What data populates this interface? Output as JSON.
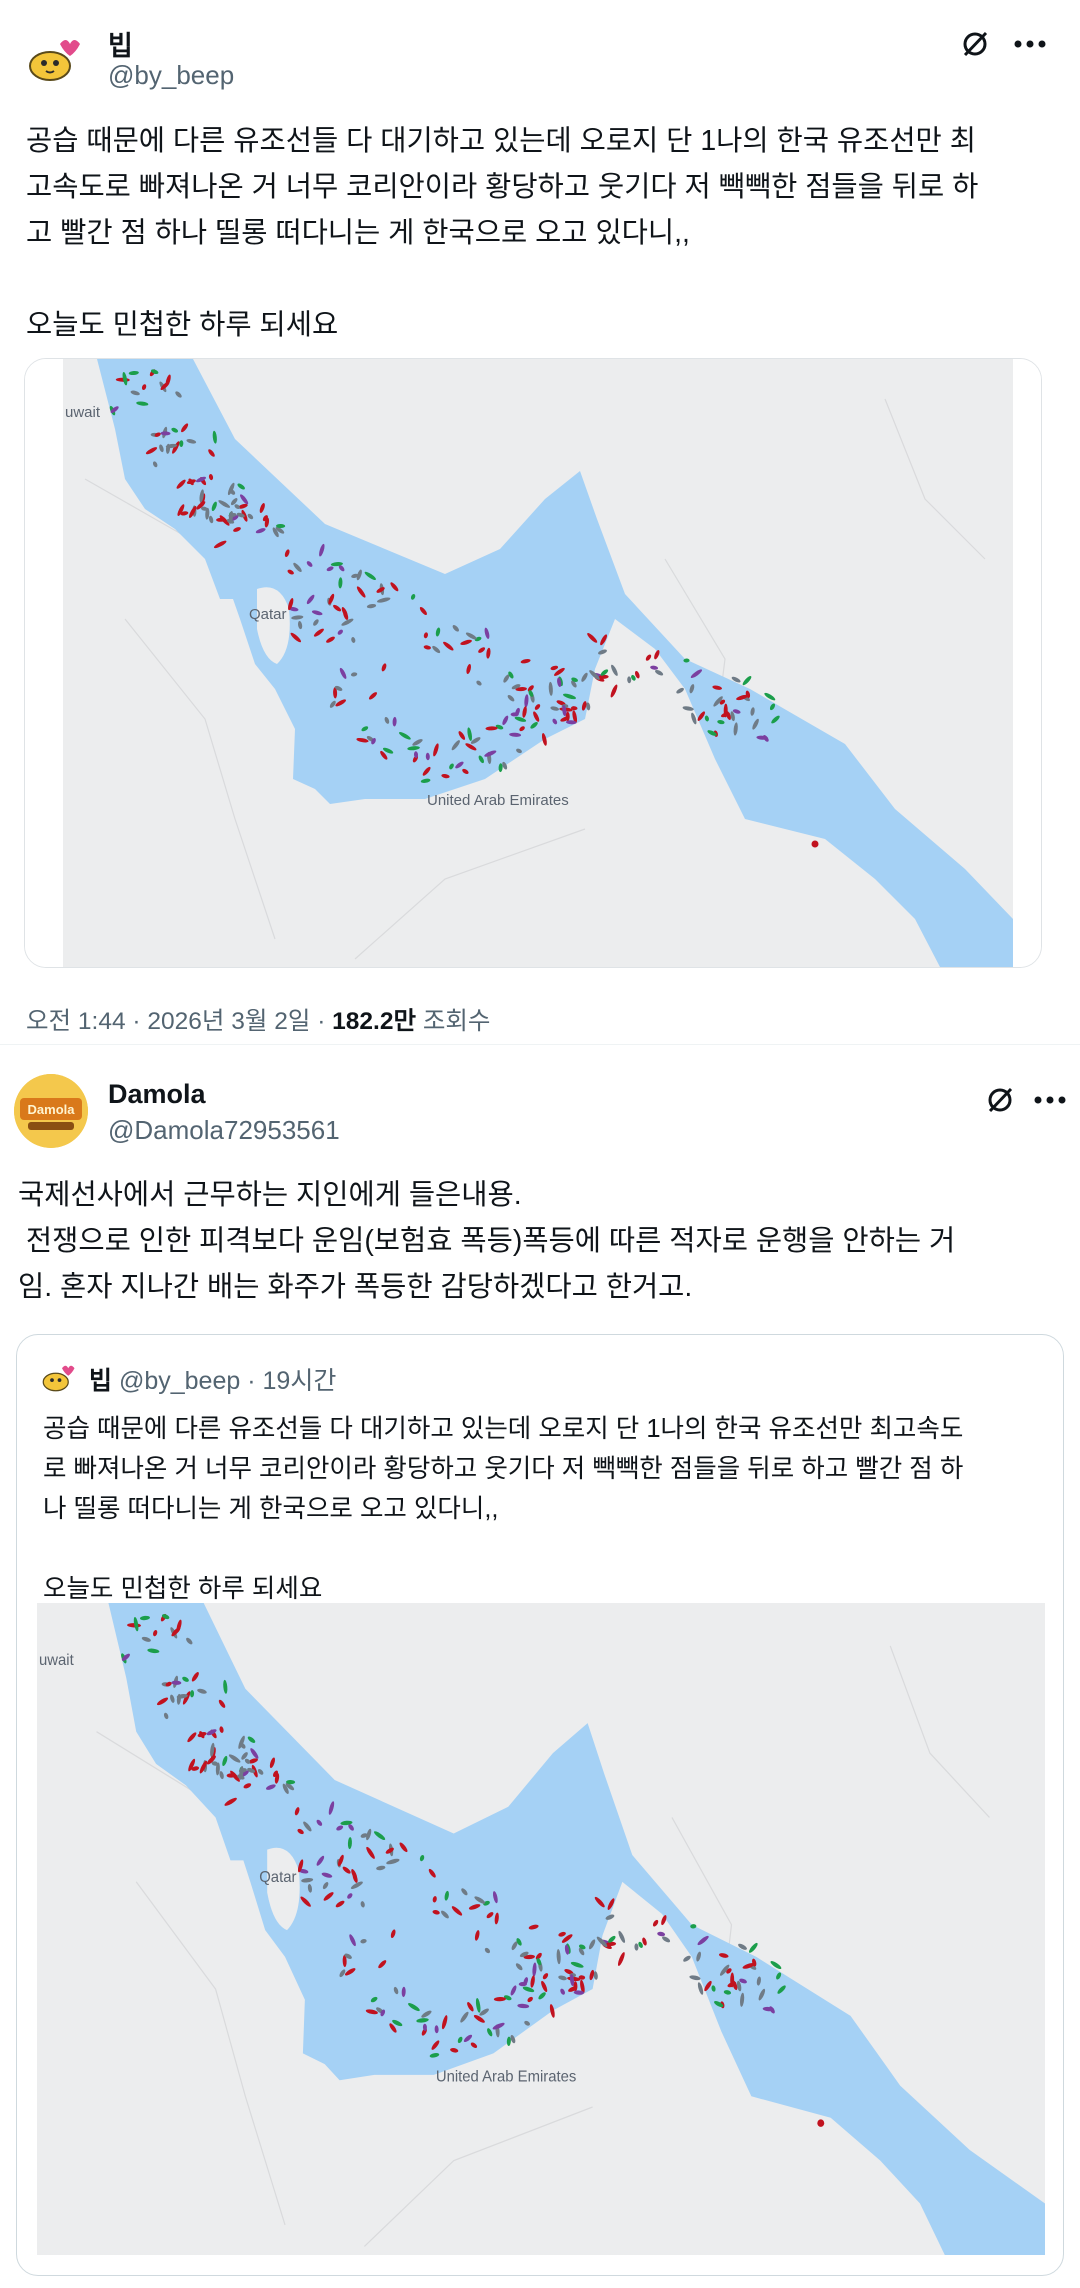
{
  "post1": {
    "author_name": "빕",
    "author_handle": "@by_beep",
    "body": "공습 때문에 다른 유조선들 다 대기하고 있는데 오로지 단 1나의 한국 유조선만 최\n고속도로 빠져나온 거 너무 코리안이라 황당하고 웃기다 저 빽빽한 점들을 뒤로 하\n고 빨간 점 하나 띨롱 떠다니는 게 한국으로 오고 있다니,,\n\n오늘도 민첩한 하루 되세요",
    "map_labels": {
      "kuwait": "uwait",
      "qatar": "Qatar",
      "uae": "United Arab Emirates"
    },
    "time": "오전 1:44",
    "date": "2026년 3월 2일",
    "separator": "·",
    "views_count": "182.2만",
    "views_label": "조회수"
  },
  "post2": {
    "author_name": "Damola",
    "author_handle": "@Damola72953561",
    "avatar_text": "Damola",
    "body": "국제선사에서 근무하는 지인에게 들은내용.\n 전쟁으로 인한 피격보다 운임(보험효 폭등)폭등에 따른 적자로 운행을 안하는 거\n임. 혼자 지나간 배는 화주가 폭등한 감당하겠다고 한거고.",
    "quote": {
      "author_name": "빕",
      "author_handle": "@by_beep",
      "separator": "·",
      "time_ago": "19시간",
      "body": "공습 때문에 다른 유조선들 다 대기하고 있는데 오로지 단 1나의 한국 유조선만 최고속도\n로 빠져나온 거 너무 코리안이라 황당하고 웃기다 저 빽빽한 점들을 뒤로 하고 빨간 점 하\n나 띨롱 떠다니는 게 한국으로 오고 있다니,,\n\n오늘도 민첩한 하루 되세요",
      "map_labels": {
        "kuwait": "uwait",
        "qatar": "Qatar",
        "uae": "United Arab Emirates"
      }
    }
  },
  "icons": {
    "grok": "slashed-circle-icon",
    "more": "more-icon",
    "avatar1": "cartoon-avatar-icon"
  },
  "colors": {
    "water": "#a5d1f5",
    "land": "#ecedee",
    "ship_red": "#c1121f",
    "ship_green": "#1b9e4b",
    "ship_purple": "#7b3fa0",
    "ship_gray": "#6f7b86"
  }
}
